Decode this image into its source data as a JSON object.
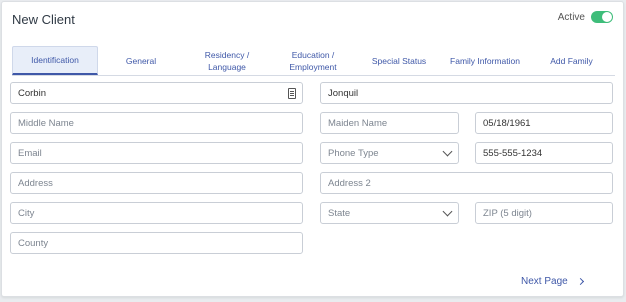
{
  "header": {
    "title": "New Client",
    "active_label": "Active",
    "active_on": true,
    "toggle_color": "#3ebd7a"
  },
  "tabs": [
    {
      "label": "Identification",
      "active": true
    },
    {
      "label": "General",
      "active": false
    },
    {
      "label": "Residency /\nLanguage",
      "active": false
    },
    {
      "label": "Education /\nEmployment",
      "active": false
    },
    {
      "label": "Special Status",
      "active": false
    },
    {
      "label": "Family Information",
      "active": false
    },
    {
      "label": "Add Family",
      "active": false
    }
  ],
  "form": {
    "first_name": {
      "value": "Corbin",
      "placeholder": ""
    },
    "last_name": {
      "value": "Jonquil",
      "placeholder": ""
    },
    "middle_name": {
      "value": "",
      "placeholder": "Middle Name"
    },
    "maiden_name": {
      "value": "",
      "placeholder": "Maiden Name"
    },
    "dob": {
      "value": "05/18/1961",
      "placeholder": ""
    },
    "email": {
      "value": "",
      "placeholder": "Email"
    },
    "phone_type": {
      "value": "Phone Type"
    },
    "phone": {
      "value": "555-555-1234",
      "placeholder": ""
    },
    "address": {
      "value": "",
      "placeholder": "Address"
    },
    "address2": {
      "value": "",
      "placeholder": "Address 2"
    },
    "city": {
      "value": "",
      "placeholder": "City"
    },
    "state": {
      "value": "State"
    },
    "zip": {
      "value": "",
      "placeholder": "ZIP (5 digit)"
    },
    "county": {
      "value": "",
      "placeholder": "County"
    }
  },
  "footer": {
    "next_label": "Next Page"
  },
  "colors": {
    "accent": "#3f58a8",
    "toggle_on": "#3ebd7a"
  }
}
